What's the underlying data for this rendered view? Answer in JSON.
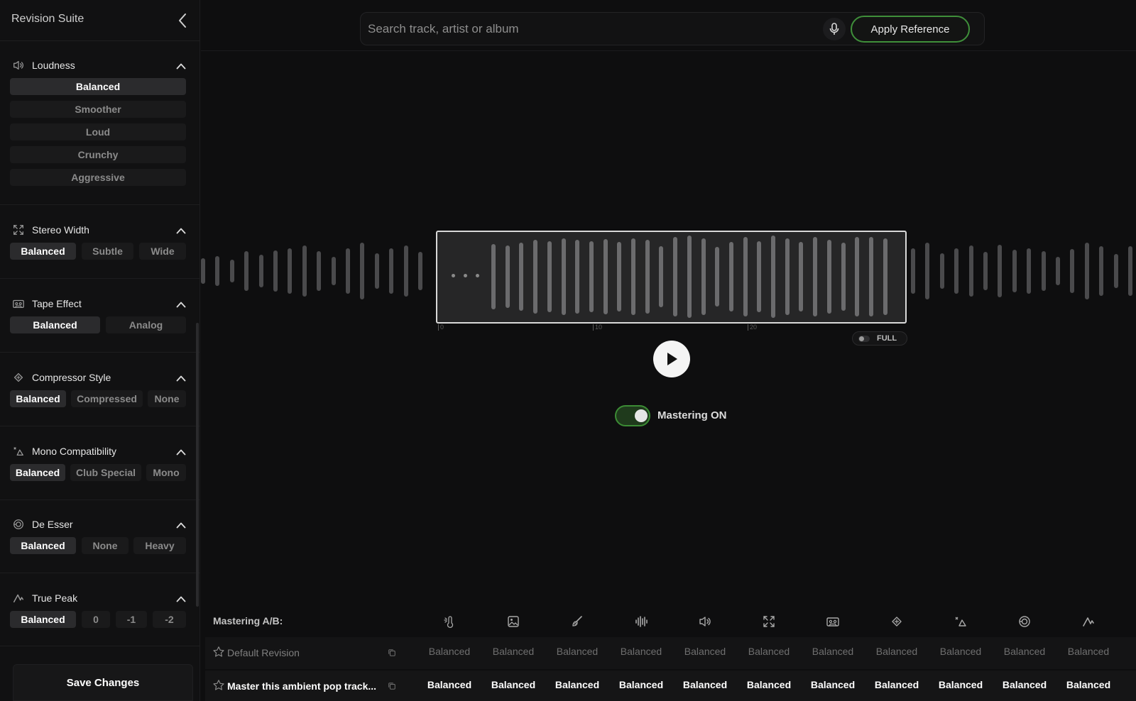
{
  "sidebar": {
    "title": "Revision Suite",
    "sections": [
      {
        "title": "Loudness",
        "icon": "speaker-icon",
        "options": [
          "Balanced",
          "Smoother",
          "Loud",
          "Crunchy",
          "Aggressive"
        ],
        "selected": "Balanced"
      },
      {
        "title": "Stereo Width",
        "icon": "expand-icon",
        "options": [
          "Balanced",
          "Subtle",
          "Wide"
        ],
        "selected": "Balanced"
      },
      {
        "title": "Tape Effect",
        "icon": "cassette-icon",
        "options": [
          "Balanced",
          "Analog"
        ],
        "selected": "Balanced"
      },
      {
        "title": "Compressor Style",
        "icon": "compress-icon",
        "options": [
          "Balanced",
          "Compressed",
          "None"
        ],
        "selected": "Balanced"
      },
      {
        "title": "Mono Compatibility",
        "icon": "mono-icon",
        "options": [
          "Balanced",
          "Club Special",
          "Mono"
        ],
        "selected": "Balanced"
      },
      {
        "title": "De Esser",
        "icon": "ear-icon",
        "options": [
          "Balanced",
          "None",
          "Heavy"
        ],
        "selected": "Balanced"
      },
      {
        "title": "True Peak",
        "icon": "peak-icon",
        "options": [
          "Balanced",
          "0",
          "-1",
          "-2"
        ],
        "selected": "Balanced"
      }
    ],
    "save_label": "Save Changes"
  },
  "search": {
    "placeholder": "Search track, artist or album",
    "value": ""
  },
  "apply_label": "Apply Reference",
  "waveform": {
    "ticks": [
      "0",
      "10",
      "20"
    ],
    "full_label": "FULL",
    "full_on": false
  },
  "mastering": {
    "label": "Mastering ON",
    "on": true
  },
  "ab": {
    "title": "Mastering A/B:",
    "columns": [
      "temperature-icon",
      "image-icon",
      "brush-icon",
      "waveform-icon",
      "speaker-icon",
      "expand-icon",
      "cassette-icon",
      "compress-icon",
      "mono-icon",
      "ear-icon",
      "peak-icon"
    ],
    "rows": [
      {
        "name": "Default Revision",
        "values": [
          "Balanced",
          "Balanced",
          "Balanced",
          "Balanced",
          "Balanced",
          "Balanced",
          "Balanced",
          "Balanced",
          "Balanced",
          "Balanced",
          "Balanced"
        ]
      },
      {
        "name": "Master this ambient pop track...",
        "values": [
          "Balanced",
          "Balanced",
          "Balanced",
          "Balanced",
          "Balanced",
          "Balanced",
          "Balanced",
          "Balanced",
          "Balanced",
          "Balanced",
          "Balanced"
        ]
      }
    ]
  },
  "colors": {
    "accent": "#3f8f3a",
    "background": "#0e0e0f",
    "panel": "#111112"
  }
}
